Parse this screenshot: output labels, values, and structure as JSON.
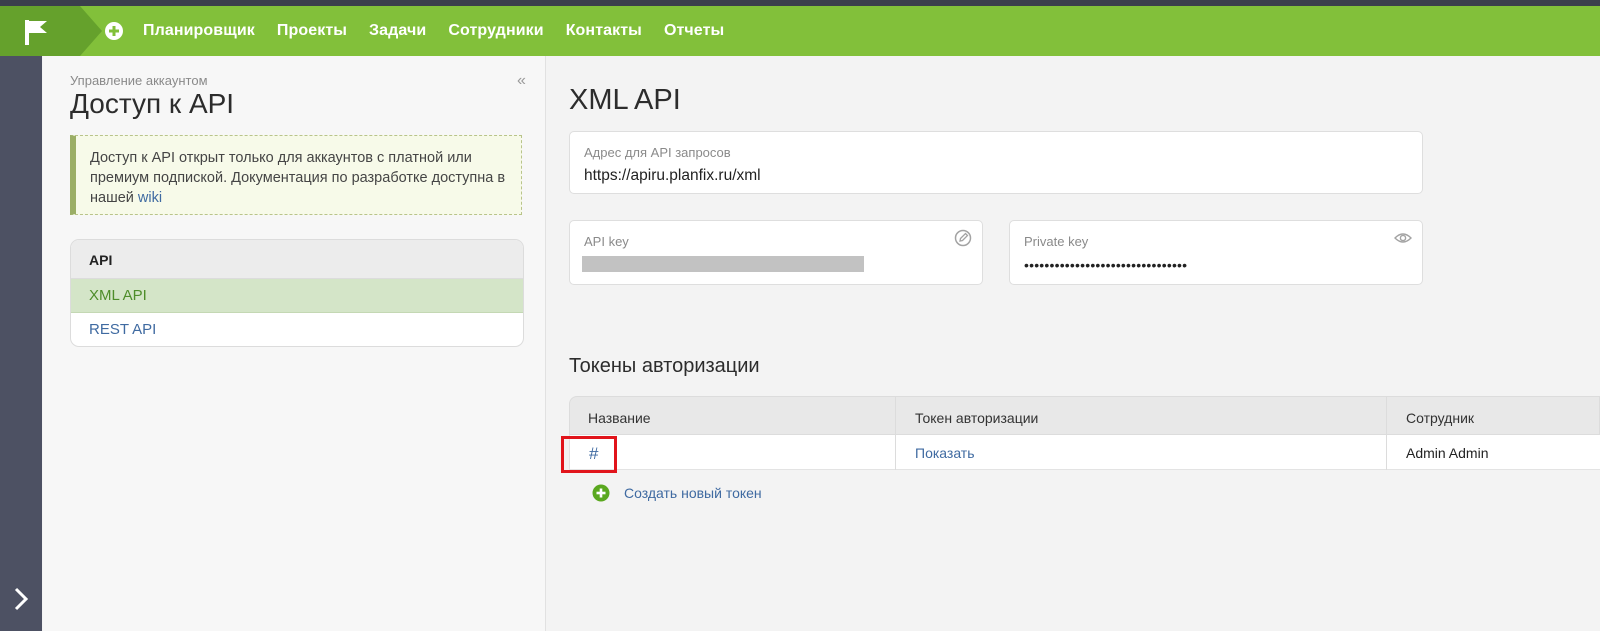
{
  "nav": {
    "items": [
      "Планировщик",
      "Проекты",
      "Задачи",
      "Сотрудники",
      "Контакты",
      "Отчеты"
    ]
  },
  "panel": {
    "breadcrumb": "Управление аккаунтом",
    "title": "Доступ к API",
    "notice_text": "Доступ к API открыт только для аккаунтов с платной или премиум подпиской. Документация по разработке доступна в нашей",
    "notice_link": "wiki",
    "list_header": "API",
    "items": [
      {
        "label": "XML API",
        "active": true
      },
      {
        "label": "REST API",
        "active": false
      }
    ]
  },
  "main": {
    "title": "XML API",
    "endpoint_label": "Адрес для API запросов",
    "endpoint_value": "https://apiru.planfix.ru/xml",
    "api_key_label": "API key",
    "private_key_label": "Private key",
    "private_key_value": "••••••••••••••••••••••••••••••••",
    "tokens_title": "Токены авторизации",
    "table": {
      "headers": [
        "Название",
        "Токен авторизации",
        "Сотрудник"
      ],
      "rows": [
        {
          "name": "#",
          "token": "Показать",
          "employee": "Admin Admin"
        }
      ]
    },
    "create_token": "Создать новый токен"
  },
  "colors": {
    "accent": "#82c03a",
    "accent_dark": "#65a12c",
    "rail": "#4d5163",
    "link": "#3f6aa1",
    "highlight": "#e1141b"
  }
}
